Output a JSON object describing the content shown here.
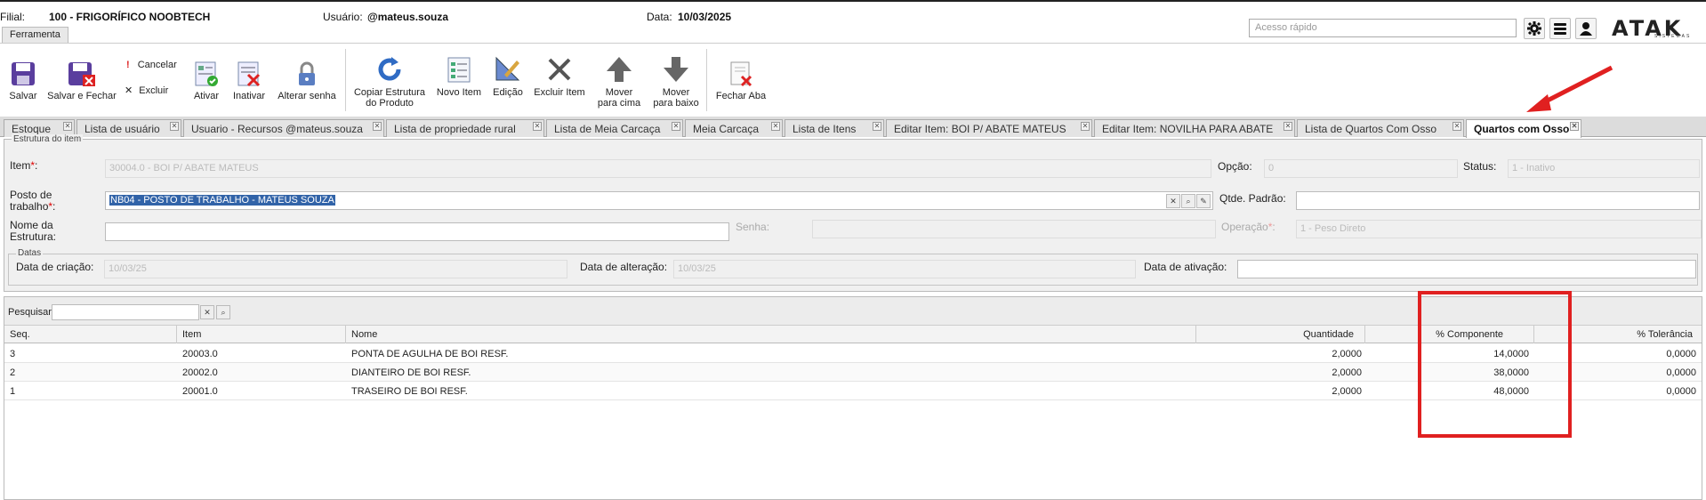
{
  "header": {
    "filial_label": "Filial:",
    "filial_value": "100 - FRIGORÍFICO NOOBTECH",
    "usuario_label": "Usuário:",
    "usuario_value": "@mateus.souza",
    "data_label": "Data:",
    "data_value": "10/03/2025",
    "quick_access_placeholder": "Acesso rápido",
    "logo_text": "ATAK",
    "logo_sub": "SISTEMAS",
    "menu_tab": "Ferramenta"
  },
  "toolbar": {
    "salvar": "Salvar",
    "salvar_fechar": "Salvar e Fechar",
    "cancelar": "Cancelar",
    "excluir": "Excluir",
    "ativar": "Ativar",
    "inativar": "Inativar",
    "alterar_senha": "Alterar senha",
    "copiar_estrutura_1": "Copiar Estrutura",
    "copiar_estrutura_2": "do Produto",
    "novo_item": "Novo Item",
    "edicao": "Edição",
    "excluir_item": "Excluir Item",
    "mover_cima_1": "Mover",
    "mover_cima_2": "para cima",
    "mover_baixo_1": "Mover",
    "mover_baixo_2": "para baixo",
    "fechar_aba": "Fechar Aba"
  },
  "tabs": [
    {
      "label": "Estoque"
    },
    {
      "label": "Lista de usuário"
    },
    {
      "label": "Usuario - Recursos @mateus.souza"
    },
    {
      "label": "Lista de propriedade rural"
    },
    {
      "label": "Lista de Meia Carcaça"
    },
    {
      "label": "Meia Carcaça"
    },
    {
      "label": "Lista de Itens"
    },
    {
      "label": "Editar Item: BOI P/ ABATE MATEUS"
    },
    {
      "label": "Editar Item: NOVILHA PARA ABATE"
    },
    {
      "label": "Lista de Quartos Com Osso"
    },
    {
      "label": "Quartos com Osso"
    }
  ],
  "form": {
    "legend": "Estrutura do item",
    "item_label": "Item",
    "item_value": "30004.0 - BOI P/ ABATE MATEUS",
    "opcao_label": "Opção:",
    "opcao_value": "0",
    "status_label": "Status:",
    "status_value": "1 - Inativo",
    "posto_label_1": "Posto de",
    "posto_label_2": "trabalho",
    "posto_value": "NB04 - POSTO DE TRABALHO - MATEUS SOUZA",
    "qtde_label": "Qtde. Padrão:",
    "qtde_value": "",
    "nome_label_1": "Nome da",
    "nome_label_2": "Estrutura:",
    "nome_value": "",
    "senha_label": "Senha:",
    "senha_value": "",
    "operacao_label": "Operação",
    "operacao_value": "1 - Peso Direto",
    "datas_legend": "Datas",
    "criacao_label": "Data de criação:",
    "criacao_value": "10/03/25",
    "alteracao_label": "Data de alteração:",
    "alteracao_value": "10/03/25",
    "ativacao_label": "Data de ativação:",
    "ativacao_value": ""
  },
  "grid": {
    "search_label": "Pesquisar",
    "search_value": "",
    "columns": [
      "Seq.",
      "Item",
      "Nome",
      "Quantidade",
      "% Componente",
      "% Tolerância"
    ],
    "rows": [
      {
        "seq": "3",
        "item": "20003.0",
        "nome": "PONTA DE AGULHA DE BOI RESF.",
        "quantidade": "2,0000",
        "componente": "14,0000",
        "tolerancia": "0,0000"
      },
      {
        "seq": "2",
        "item": "20002.0",
        "nome": "DIANTEIRO DE BOI RESF.",
        "quantidade": "2,0000",
        "componente": "38,0000",
        "tolerancia": "0,0000"
      },
      {
        "seq": "1",
        "item": "20001.0",
        "nome": "TRASEIRO DE BOI RESF.",
        "quantidade": "2,0000",
        "componente": "48,0000",
        "tolerancia": "0,0000"
      }
    ]
  },
  "colors": {
    "annotation": "#e02020",
    "selection": "#3163a8"
  }
}
